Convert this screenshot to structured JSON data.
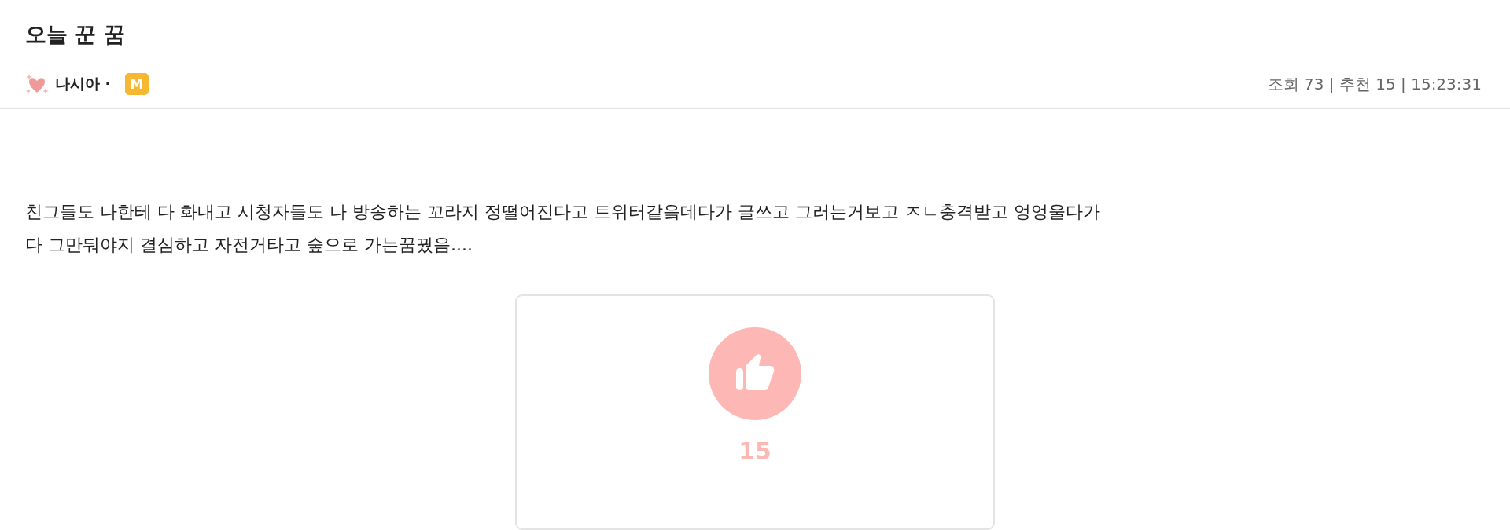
{
  "post": {
    "title": "오늘 꾼 꿈",
    "author": {
      "name": "나시아 ·",
      "badge": "M"
    },
    "meta": "조회 73 | 추천 15 | 15:23:31",
    "body": [
      "친그들도 나한테 다 화내고 시청자들도 나 방송하는 꼬라지 정떨어진다고 트위터같읔데다가 글쓰고 그러는거보고 ㅈㄴ충격받고 엉엉울다가",
      "다 그만둬야지 결심하고 자전거타고 숲으로 가는꿈꿨음...."
    ],
    "recommend": {
      "count": "15"
    }
  }
}
